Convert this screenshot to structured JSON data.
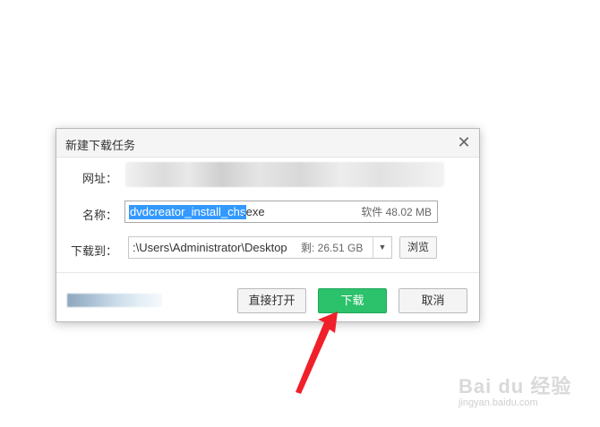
{
  "dialog": {
    "title": "新建下载任务",
    "close_glyph": "✕",
    "url_label": "网址：",
    "name_label": "名称：",
    "name_selected": "dvdcreator_install_chs",
    "name_ext": ".exe",
    "file_size": "软件 48.02 MB",
    "saveto_label": "下载到：",
    "save_path": ":\\Users\\Administrator\\Desktop",
    "free_space": "剩: 26.51 GB",
    "dropdown_glyph": "▼",
    "browse_label": "浏览",
    "open_label": "直接打开",
    "download_label": "下载",
    "cancel_label": "取消"
  },
  "colors": {
    "download_button": "#2cc16b",
    "selection": "#3399ff",
    "arrow": "#f0202a"
  },
  "watermark": {
    "brand": "Bai du 经验",
    "site": "jingyan.baidu.com"
  }
}
